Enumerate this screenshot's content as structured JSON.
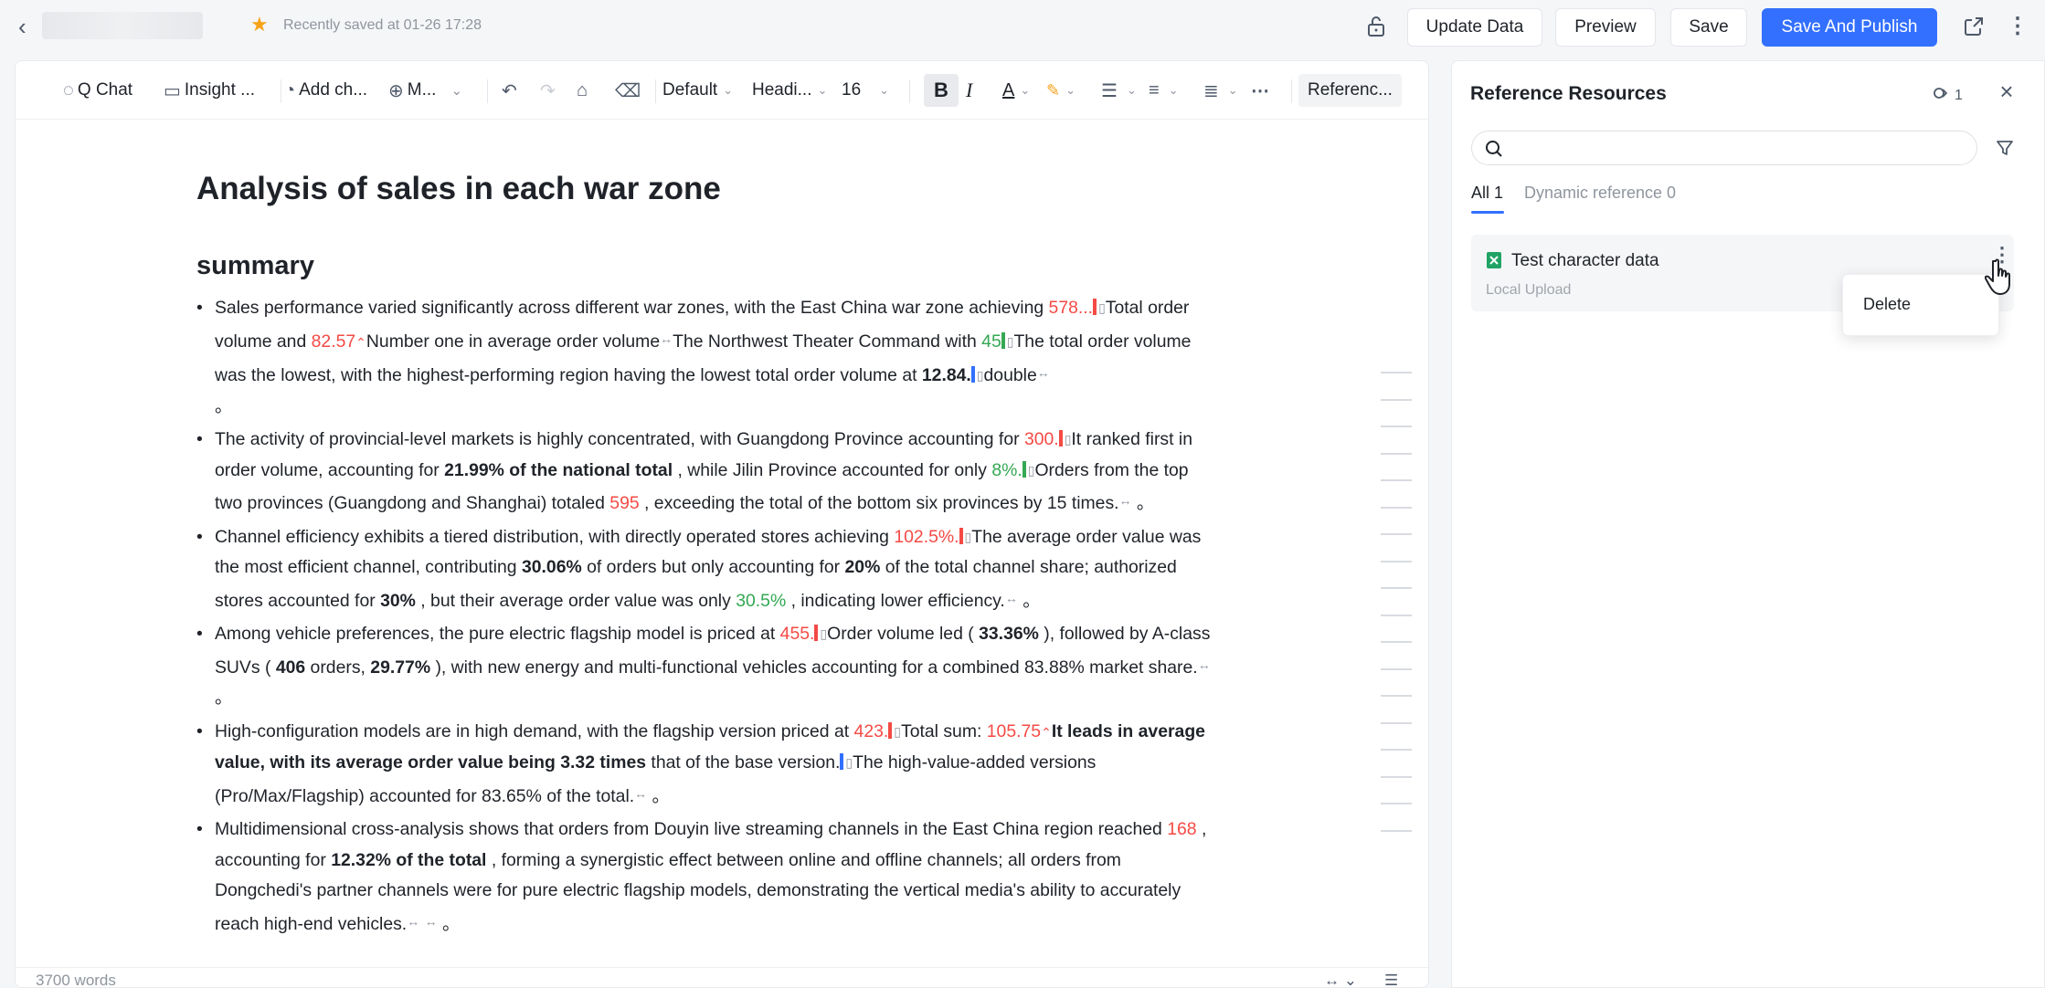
{
  "header": {
    "saved_text": "Recently saved at 01-26 17:28",
    "buttons": {
      "update_data": "Update Data",
      "preview": "Preview",
      "save": "Save",
      "save_publish": "Save And Publish"
    },
    "accent_color": "#3370ff"
  },
  "toolbar": {
    "q_chat": "Q Chat",
    "insight": "Insight ...",
    "add_chart": "Add ch...",
    "more_m": "M...",
    "font_style": "Default",
    "heading": "Headi...",
    "font_size": "16",
    "reference": "Referenc..."
  },
  "document": {
    "title": "Analysis of sales in each war zone",
    "section": "summary",
    "b1": {
      "t1": "Sales performance varied significantly across different war zones, with the East China war zone achieving ",
      "v1": "578...",
      "t2": "Total order volume and ",
      "v2": "82.57",
      "t3": "Number one in average order volume",
      "t4": "The Northwest Theater Command with ",
      "v3": "45",
      "t5": "The total order volume was the lowest, with the highest-performing region having the lowest total order volume at ",
      "v4": "12.84.",
      "t6": "double",
      "t7": "。"
    },
    "b2": {
      "t1": "The activity of provincial-level markets is highly concentrated, with Guangdong Province accounting for ",
      "v1": "300.",
      "t2": "It ranked first in order volume, accounting for ",
      "v2": "21.99% of the national total",
      "t3": " , while Jilin Province accounted for only ",
      "v3": "8%.",
      "t4": "Orders from the top two provinces (Guangdong and Shanghai) totaled ",
      "v4": "595",
      "t5": " , exceeding the total of the bottom six provinces by 15 times.",
      "t6": " 。"
    },
    "b3": {
      "t1": "Channel efficiency exhibits a tiered distribution, with directly operated stores achieving ",
      "v1": "102.5%.",
      "t2": "The average order value was the most efficient channel, contributing ",
      "v2": "30.06%",
      "t3": " of orders but only accounting for ",
      "v3": "20%",
      "t4": " of the total channel share; authorized stores accounted for ",
      "v4": "30%",
      "t5": " , but their average order value was only ",
      "v5": "30.5%",
      "t6": " , indicating lower efficiency.",
      "t7": " 。"
    },
    "b4": {
      "t1": "Among vehicle preferences, the pure electric flagship model is priced at ",
      "v1": "455.",
      "t2": "Order volume led ( ",
      "v2": "33.36%",
      "t3": " ), followed by A-class SUVs ( ",
      "v3": "406",
      "t4": " orders, ",
      "v4": "29.77%",
      "t5": " ), with new energy and multi-functional vehicles accounting for a combined 83.88% market share.",
      "t6": " 。"
    },
    "b5": {
      "t1": "High-configuration models are in high demand, with the flagship version priced at ",
      "v1": "423.",
      "t2": "Total sum: ",
      "v2": "105.75",
      "v3": "It leads in average value, with its average order value being 3.32 times",
      "t3": " that of the base version.",
      "t4": "The high-value-added versions (Pro/Max/Flagship) accounted for 83.65% of the total.",
      "t5": " 。"
    },
    "b6": {
      "t1": "Multidimensional cross-analysis shows that orders from Douyin live streaming channels in the East China region reached ",
      "v1": "168",
      "t2": " , accounting for ",
      "v2": "12.32% of the total",
      "t3": " , forming a synergistic effect between online and offline channels; all orders from Dongchedi's partner channels were for pure electric flagship models, demonstrating the vertical media's ability to accurately reach high-end vehicles.",
      "t4": " 。"
    },
    "word_count": "3700 words"
  },
  "panel": {
    "title": "Reference Resources",
    "count": "1",
    "search_placeholder": "",
    "tabs": [
      "All 1",
      "Dynamic reference 0"
    ],
    "resource": {
      "name": "Test character data",
      "source": "Local Upload"
    },
    "menu": {
      "delete": "Delete"
    }
  }
}
